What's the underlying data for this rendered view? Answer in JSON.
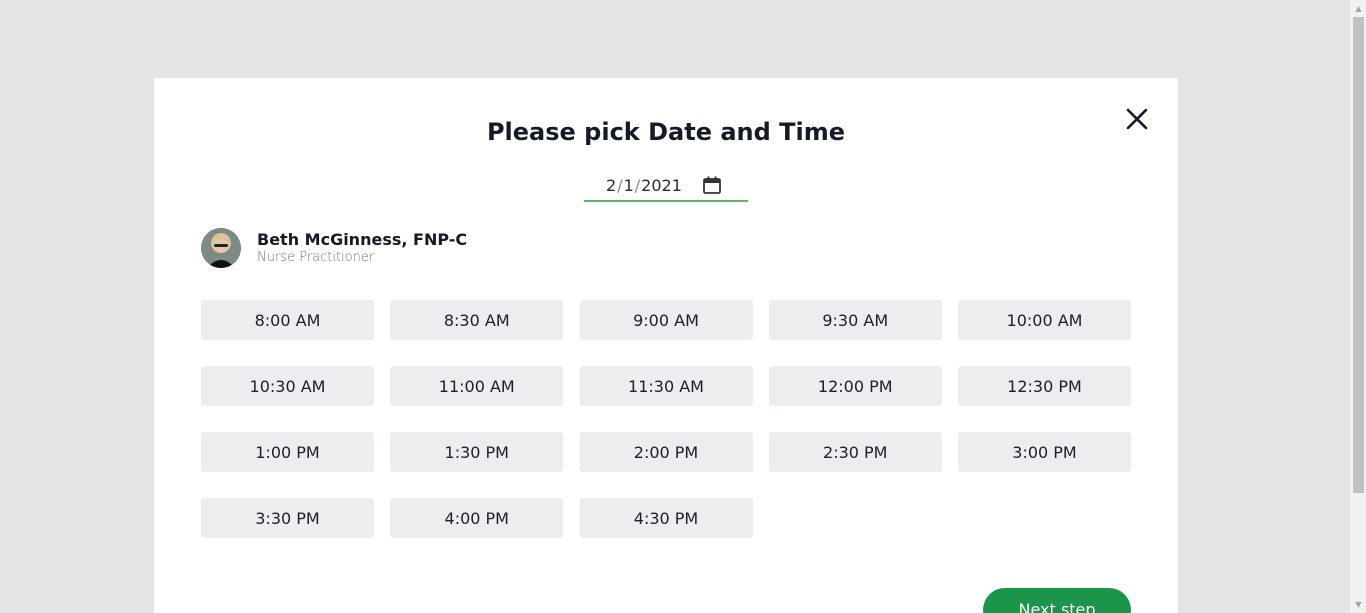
{
  "modal": {
    "title": "Please pick Date and Time",
    "close_icon": "close-icon",
    "date": {
      "month": "2",
      "day": "1",
      "year": "2021",
      "separator": "/",
      "icon": "calendar-icon"
    },
    "provider": {
      "name": "Beth McGinness, FNP-C",
      "role": "Nurse Practitioner"
    },
    "slots": [
      "8:00 AM",
      "8:30 AM",
      "9:00 AM",
      "9:30 AM",
      "10:00 AM",
      "10:30 AM",
      "11:00 AM",
      "11:30 AM",
      "12:00 PM",
      "12:30 PM",
      "1:00 PM",
      "1:30 PM",
      "2:00 PM",
      "2:30 PM",
      "3:00 PM",
      "3:30 PM",
      "4:00 PM",
      "4:30 PM"
    ],
    "next_label": "Next step"
  },
  "colors": {
    "accent": "#1a9549",
    "date_underline": "#5cb85c",
    "slot_bg": "#ecedee",
    "backdrop": "#e5e5e5"
  }
}
